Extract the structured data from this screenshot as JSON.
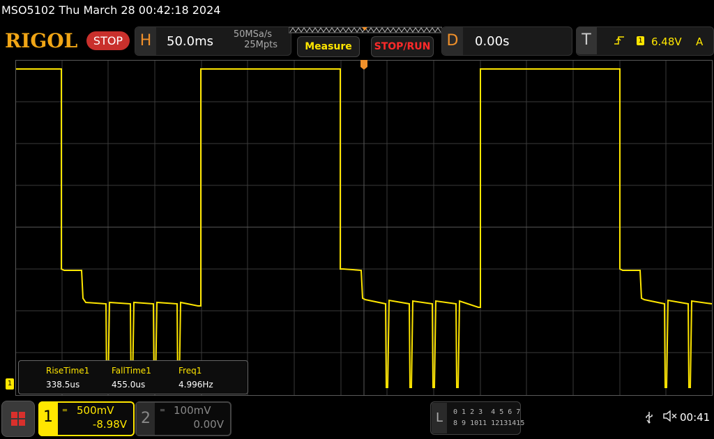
{
  "header": {
    "title": "MSO5102  Thu March 28 00:42:18 2024"
  },
  "status": {
    "logo": "RIGOL",
    "run_state": "STOP",
    "horizontal": {
      "tag": "H",
      "timebase": "50.0ms",
      "sample_rate": "50MSa/s",
      "memory_depth": "25Mpts"
    },
    "buttons": {
      "measure": "Measure",
      "stop_run": "STOP/RUN"
    },
    "delay": {
      "tag": "D",
      "value": "0.00s"
    },
    "trigger": {
      "tag": "T",
      "channel": "1",
      "level": "6.48V",
      "mode": "A",
      "edge_icon": "rising-edge-icon"
    }
  },
  "measurements": {
    "items": [
      {
        "label": "RiseTime1",
        "value": "338.5us"
      },
      {
        "label": "FallTime1",
        "value": "455.0us"
      },
      {
        "label": "Freq1",
        "value": "4.996Hz"
      }
    ]
  },
  "channels": {
    "ch1": {
      "number": "1",
      "scale": "500mV",
      "offset": "-8.98V",
      "marker": "1",
      "color": "#ffe600"
    },
    "ch2": {
      "number": "2",
      "scale": "100mV",
      "offset": "0.00V",
      "color": "#888888"
    }
  },
  "logic": {
    "tag": "L",
    "row1": "0 1 2 3  4 5 6 7",
    "row2": "8 9 1011 12131415"
  },
  "system": {
    "clock": "00:41",
    "usb_icon": "usb-icon",
    "mute_icon": "speaker-mute-icon"
  },
  "colors": {
    "trace": "#ffe600",
    "accent": "#f1a616",
    "stop": "#c9302c"
  }
}
